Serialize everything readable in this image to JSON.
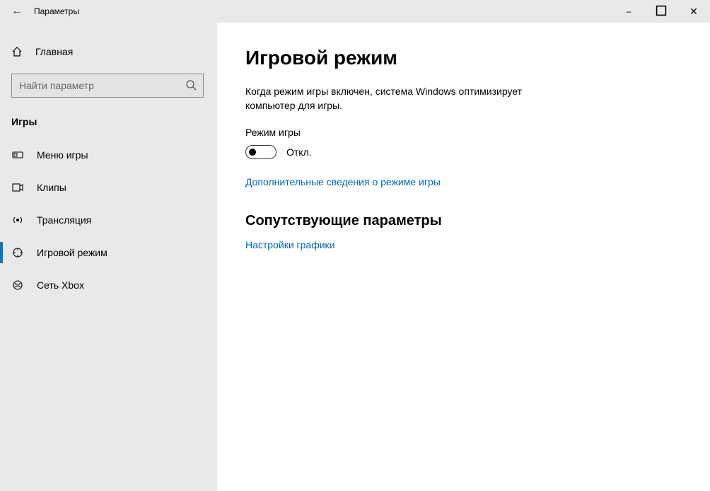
{
  "window": {
    "title": "Параметры"
  },
  "sidebar": {
    "home_label": "Главная",
    "search_placeholder": "Найти параметр",
    "category": "Игры",
    "items": [
      {
        "label": "Меню игры"
      },
      {
        "label": "Клипы"
      },
      {
        "label": "Трансляция"
      },
      {
        "label": "Игровой режим"
      },
      {
        "label": "Сеть Xbox"
      }
    ],
    "selected_index": 3
  },
  "main": {
    "heading": "Игровой режим",
    "description": "Когда режим игры включен, система Windows оптимизирует компьютер для игры.",
    "toggle_title": "Режим игры",
    "toggle_state_label": "Откл.",
    "toggle_on": false,
    "learn_more": "Дополнительные сведения о режиме игры",
    "related_heading": "Сопутствующие параметры",
    "related_link": "Настройки графики"
  }
}
